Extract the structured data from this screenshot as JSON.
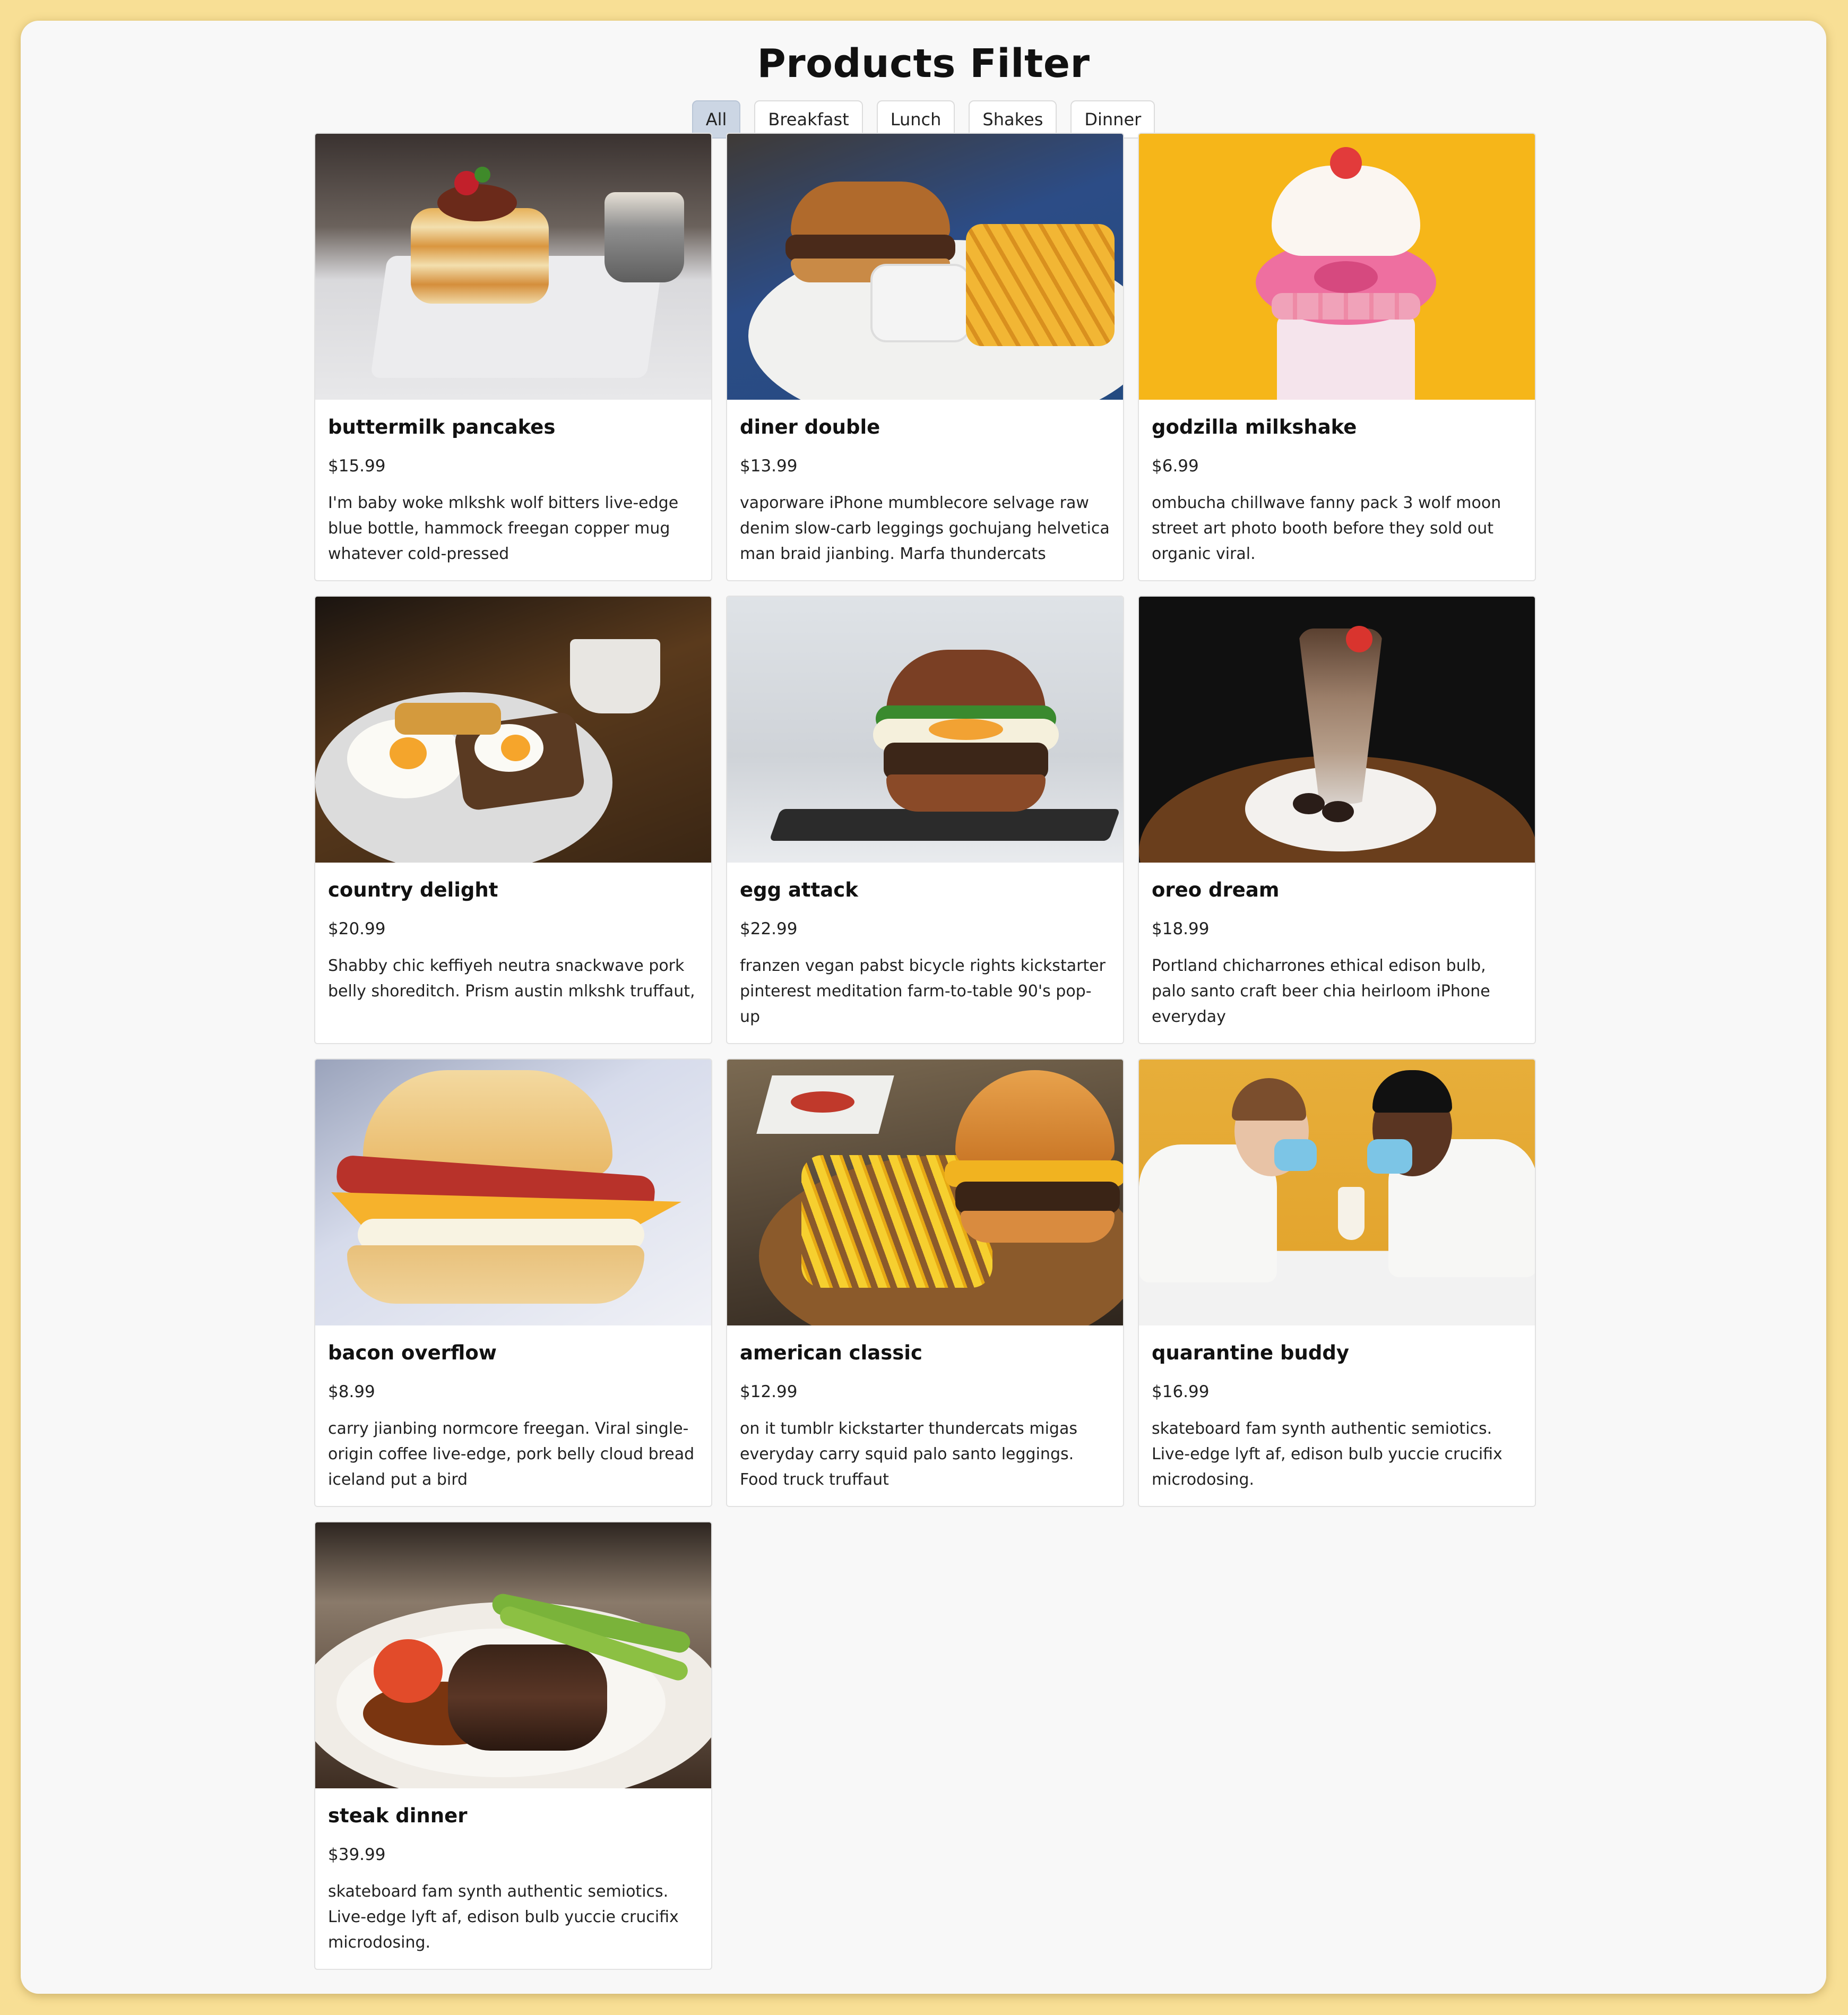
{
  "page": {
    "title": "Products Filter"
  },
  "filters": [
    {
      "label": "All",
      "active": true
    },
    {
      "label": "Breakfast",
      "active": false
    },
    {
      "label": "Lunch",
      "active": false
    },
    {
      "label": "Shakes",
      "active": false
    },
    {
      "label": "Dinner",
      "active": false
    }
  ],
  "products": [
    {
      "name": "buttermilk pancakes",
      "price": "$15.99",
      "description": "I'm baby woke mlkshk wolf bitters live-edge blue bottle, hammock freegan copper mug whatever cold-pressed",
      "image": "pancakes-photo"
    },
    {
      "name": "diner double",
      "price": "$13.99",
      "description": "vaporware iPhone mumblecore selvage raw denim slow-carb leggings gochujang helvetica man braid jianbing. Marfa thundercats",
      "image": "burger-fries-photo"
    },
    {
      "name": "godzilla milkshake",
      "price": "$6.99",
      "description": "ombucha chillwave fanny pack 3 wolf moon street art photo booth before they sold out organic viral.",
      "image": "donut-milkshake-photo"
    },
    {
      "name": "country delight",
      "price": "$20.99",
      "description": "Shabby chic keffiyeh neutra snackwave pork belly shoreditch. Prism austin mlkshk truffaut,",
      "image": "eggs-toast-photo"
    },
    {
      "name": "egg attack",
      "price": "$22.99",
      "description": "franzen vegan pabst bicycle rights kickstarter pinterest meditation farm-to-table 90's pop-up",
      "image": "egg-burger-photo"
    },
    {
      "name": "oreo dream",
      "price": "$18.99",
      "description": "Portland chicharrones ethical edison bulb, palo santo craft beer chia heirloom iPhone everyday",
      "image": "chocolate-shake-photo"
    },
    {
      "name": "bacon overflow",
      "price": "$8.99",
      "description": "carry jianbing normcore freegan. Viral single-origin coffee live-edge, pork belly cloud bread iceland put a bird",
      "image": "biscuit-sandwich-photo"
    },
    {
      "name": "american classic",
      "price": "$12.99",
      "description": "on it tumblr kickstarter thundercats migas everyday carry squid palo santo leggings. Food truck truffaut",
      "image": "cheeseburger-fries-photo"
    },
    {
      "name": "quarantine buddy",
      "price": "$16.99",
      "description": "skateboard fam synth authentic semiotics. Live-edge lyft af, edison bulb yuccie crucifix microdosing.",
      "image": "couple-milkshake-photo"
    },
    {
      "name": "steak dinner",
      "price": "$39.99",
      "description": "skateboard fam synth authentic semiotics. Live-edge lyft af, edison bulb yuccie crucifix microdosing.",
      "image": "steak-plate-photo"
    }
  ],
  "colors": {
    "background": "#f8df95",
    "panel": "#f8f8f8",
    "active_filter": "#ccd6e4"
  }
}
